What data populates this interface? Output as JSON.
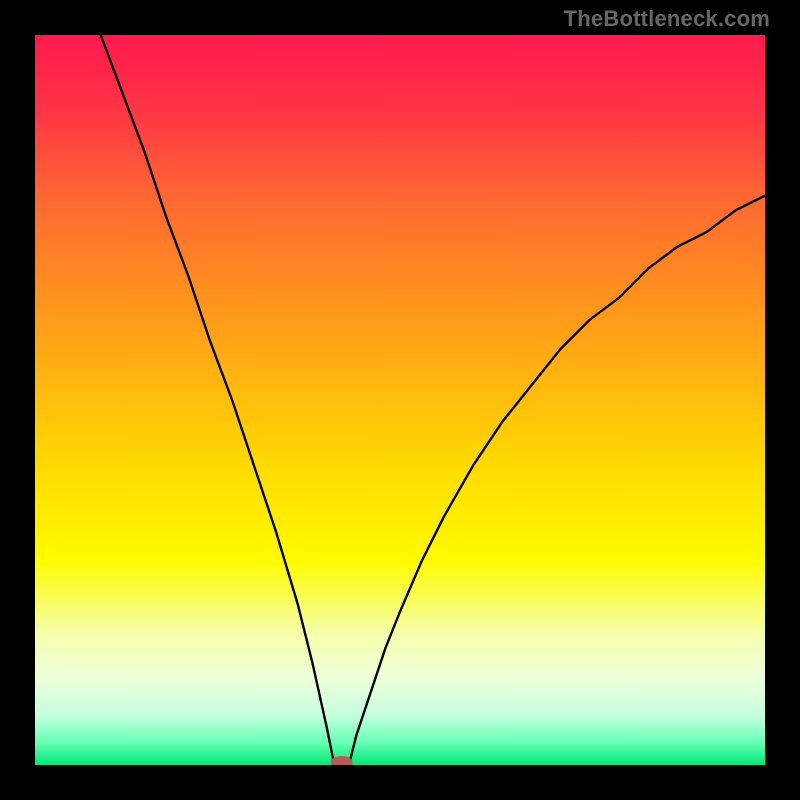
{
  "watermark": "TheBottleneck.com",
  "chart_data": {
    "type": "line",
    "title": "",
    "xlabel": "",
    "ylabel": "",
    "xlim": [
      0,
      100
    ],
    "ylim": [
      0,
      100
    ],
    "grid": false,
    "legend": false,
    "notch_x": 42,
    "curve_points": [
      {
        "x": 9,
        "y": 100
      },
      {
        "x": 12,
        "y": 92
      },
      {
        "x": 15,
        "y": 84
      },
      {
        "x": 18,
        "y": 75
      },
      {
        "x": 21,
        "y": 67
      },
      {
        "x": 24,
        "y": 58
      },
      {
        "x": 27,
        "y": 50
      },
      {
        "x": 30,
        "y": 41
      },
      {
        "x": 33,
        "y": 32
      },
      {
        "x": 36,
        "y": 22
      },
      {
        "x": 38,
        "y": 14
      },
      {
        "x": 40,
        "y": 5
      },
      {
        "x": 41,
        "y": 0
      },
      {
        "x": 43,
        "y": 0
      },
      {
        "x": 44,
        "y": 4
      },
      {
        "x": 46,
        "y": 10
      },
      {
        "x": 48,
        "y": 16
      },
      {
        "x": 50,
        "y": 21
      },
      {
        "x": 53,
        "y": 28
      },
      {
        "x": 56,
        "y": 34
      },
      {
        "x": 60,
        "y": 41
      },
      {
        "x": 64,
        "y": 47
      },
      {
        "x": 68,
        "y": 52
      },
      {
        "x": 72,
        "y": 57
      },
      {
        "x": 76,
        "y": 61
      },
      {
        "x": 80,
        "y": 64
      },
      {
        "x": 84,
        "y": 68
      },
      {
        "x": 88,
        "y": 71
      },
      {
        "x": 92,
        "y": 73
      },
      {
        "x": 96,
        "y": 76
      },
      {
        "x": 100,
        "y": 78
      }
    ],
    "gradient_stops": [
      {
        "offset": 0.0,
        "color": "#ff1a4d"
      },
      {
        "offset": 0.1,
        "color": "#ff3346"
      },
      {
        "offset": 0.22,
        "color": "#ff6633"
      },
      {
        "offset": 0.35,
        "color": "#ff8f1f"
      },
      {
        "offset": 0.48,
        "color": "#ffb80f"
      },
      {
        "offset": 0.6,
        "color": "#ffdd00"
      },
      {
        "offset": 0.72,
        "color": "#fffb00"
      },
      {
        "offset": 0.82,
        "color": "#f5ffab"
      },
      {
        "offset": 0.88,
        "color": "#eeffd9"
      },
      {
        "offset": 0.93,
        "color": "#c9ffe0"
      },
      {
        "offset": 0.97,
        "color": "#66ffb3"
      },
      {
        "offset": 1.0,
        "color": "#00e676"
      }
    ],
    "marker": {
      "x": 42,
      "y": 0,
      "color": "#b85a5a",
      "rx": 11,
      "ry": 6
    }
  }
}
